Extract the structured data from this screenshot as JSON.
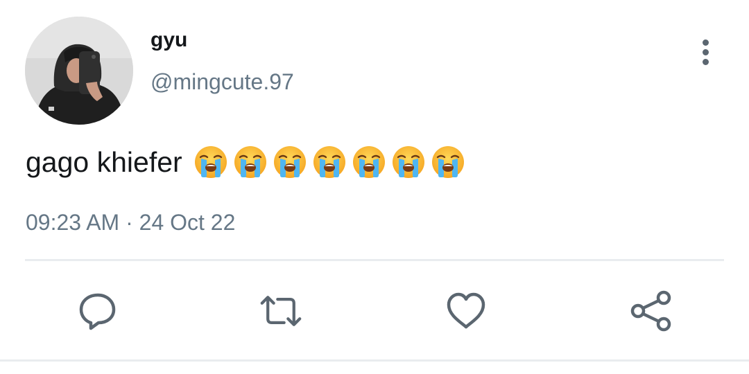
{
  "tweet": {
    "display_name": "gyu",
    "handle": "@mingcute.97",
    "text": "gago khiefer",
    "emoji_name": "loudly-crying-face-emoji",
    "emoji_count": 7,
    "timestamp": "09:23 AM · 24 Oct 22"
  },
  "actions": {
    "reply_icon": "reply-icon",
    "retweet_icon": "retweet-icon",
    "like_icon": "heart-icon",
    "share_icon": "share-icon"
  },
  "colors": {
    "text": "#14171a",
    "secondary_text": "#657786",
    "icon": "#5b6670",
    "divider": "#e9ecef"
  }
}
